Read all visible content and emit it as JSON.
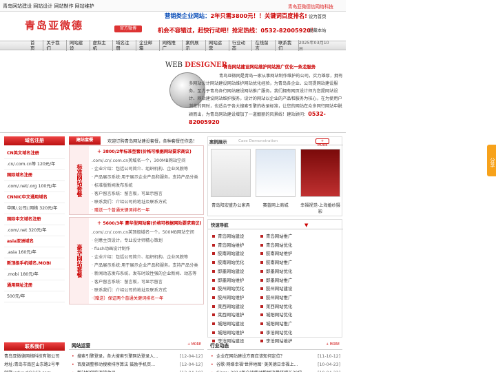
{
  "topbar": {
    "left": "青岛网站建设 网站设计 网站制作 网站维护",
    "right": "青岛亚微德信网络科技"
  },
  "logo": "青岛亚微德",
  "badge": "官方微博",
  "slogan1_a": "营销类企业网站：",
  "slogan1_b": "2年只需3800元！！关键词百度排名!",
  "slogan2": "机会不容错过，赶快行动吧！抢定热线：0532-82005920！",
  "set_home": "设为首页",
  "favorite": "收藏本站",
  "nav": [
    "首 页",
    "关于我们",
    "网站建设",
    "虚拟主机",
    "域名注册",
    "企业邮箱",
    "网络推广",
    "案例展示",
    "网站运营",
    "行业动态",
    "在线留言",
    "联系我们"
  ],
  "date": "2025年03月10日",
  "hero": {
    "web": "WEB",
    "designer": "DESIGNER",
    "tag": "青岛网站建设网站维护网站推广优化一条龙服务",
    "text": "青岛亚微网是青岛一家从事网站制作维护的公司，实力雄厚，拥有多网站设计网站建设网站维护网站优化经验，为青岛各企业、公司提网站建设服务，至力于青岛各行网站建设网站推广服务。我们拥有网页设计师为您提网站设计、网站建设网站维护服务，设计的网站以企业的产品和服务为核心，在为使用户浏览的同时，也适合于各大搜索引擎的收录标准，让您的网站在众多同行网站中脱颖而出，为青岛网站建设增加了一道靓丽的风景线！建站顾问：",
    "phone": "0532-82005920"
  },
  "sidebar": {
    "title": "域名注册",
    "items": [
      {
        "t": "CN英文域名注册",
        "red": true
      },
      {
        "t": ".cn/.com.cn等 120元/年",
        "red": false
      },
      {
        "t": "国际域名注册",
        "red": true
      },
      {
        "t": ".com/.net/.org 100元/年",
        "red": false
      },
      {
        "t": "CNNIC中文通用域名",
        "red": true
      },
      {
        "t": "中国/.公司/.网络 320元/年",
        "red": false
      },
      {
        "t": "国际中文域名注册",
        "red": true
      },
      {
        "t": ".com/.net 320元/年",
        "red": false
      },
      {
        "t": "asia亚洲域名",
        "red": true
      },
      {
        "t": ".asia 160元/年",
        "red": false
      },
      {
        "t": "新顶级手机域名.MOBI",
        "red": true
      },
      {
        "t": ".mobi 180元/年",
        "red": false
      },
      {
        "t": "通用网址注册",
        "red": true
      },
      {
        "t": "500元/年",
        "red": false
      }
    ]
  },
  "pkg_head": {
    "tab": "建站套餐",
    "text": "欢迎订购青岛网站建设套餐，各种套餐任你选！"
  },
  "pkg1": {
    "side": "标准网站套餐",
    "head": "＋ 3800/2年标准型套(价格可根据网站要求商议)",
    "items": [
      {
        "t": ".com/.cn/.com.cn英域名一个，300MB网站空间",
        "red": false
      },
      {
        "t": "· 企业介绍：包括公司简介、组织机构、企业风貌等",
        "red": false
      },
      {
        "t": "· 产品展示系统:用于展示企业产品和服务。支持产品分类",
        "red": false
      },
      {
        "t": "· 标准版新闻发布系统",
        "red": false
      },
      {
        "t": "· 客户留言系统：留言板，可显示留言",
        "red": false
      },
      {
        "t": "· 联系我们：介绍公司的地址及联系方式",
        "red": false
      },
      {
        "t": "· 赠送一个普通关键词排名一年",
        "red": true
      }
    ]
  },
  "pkg2": {
    "side": "豪华网站套餐",
    "head": "＋ 5600/3年 豪华型网站套(价格可根据网站要求商议)",
    "items": [
      {
        "t": ".com/.cn/.com.cn英顶级域名一个，500MB网站空间",
        "red": false
      },
      {
        "t": "· 创意主页设计，专业设计师精心策划",
        "red": false
      },
      {
        "t": "· flash动画设计制作",
        "red": false
      },
      {
        "t": "· 企业介绍：包括公司简介、组织机构、企业风貌等",
        "red": false
      },
      {
        "t": "· 产品展示系统:用于展示企业产品和服务。支持产品分类",
        "red": false
      },
      {
        "t": "· 新闻动态发布系统，发布时效性强的企业新闻、动态等",
        "red": false
      },
      {
        "t": "· 客户留言系统：留言板，可显示留言",
        "red": false
      },
      {
        "t": "· 联系我们：介绍公司的地址及联系方式",
        "red": false
      },
      {
        "t": "·（赠送）保证两个普通关键词排名一年",
        "red": true
      }
    ]
  },
  "cases": {
    "title": "案例展示",
    "sub": "Case Demonstration",
    "more": "+ MORE",
    "items": [
      "青岛阳宏盛办公家具",
      "赛普网上商城",
      "幸福视觉-上海婚纱摄影"
    ]
  },
  "quick": {
    "title": "快速导航",
    "col1": [
      "青岛网站建设",
      "青岛网站维护",
      "胶南网站建设",
      "胶南网站优化",
      "即墨网站建设",
      "即墨网站维护",
      "胶州网站优化",
      "胶州网站维护",
      "莱西网站建设",
      "莱西网站维护",
      "城阳网站建设",
      "城阳网站维护",
      "李沧网站建设"
    ],
    "col2": [
      "青岛网站推广",
      "青岛网站优化",
      "胶南网站维护",
      "胶南网站推广",
      "即墨网站优化",
      "即墨网站推广",
      "胶州网站建设",
      "胶州网站推广",
      "莱西网站优化",
      "城阳网站优化",
      "城阳网站推广",
      "李沧网站优化",
      "李沧网站维护"
    ]
  },
  "contact": {
    "title": "联系我们",
    "lines": [
      "青岛亚微德网络科技有限公司",
      "地址:青岛市南区山东路2号甲",
      "邮箱:qdywd@163.com"
    ]
  },
  "ops": {
    "title": "网站运营",
    "more": "+ MORE",
    "items": [
      {
        "t": "搜索引擎登录，各大搜索引擎网站登录入...",
        "d": "[12-04-12]"
      },
      {
        "t": "百度调整移动搜索排序算法 鼓励手机页...",
        "d": "[12-04-12]"
      },
      {
        "t": "新站如何快速被收录",
        "d": "[12-04-10]"
      }
    ]
  },
  "industry": {
    "title": "行业动态",
    "more": "+ MORE",
    "items": [
      {
        "t": "企业在网站建设方面应该知何定位？",
        "d": "[11-10-12]"
      },
      {
        "t": "谷歌·网络幸福'世界地图' 美英德日幸福上...",
        "d": "[10-04-23]"
      },
      {
        "t": "Cisco: 2014年全球移动数据流量将增长39倍",
        "d": "[10-04-23]"
      }
    ]
  },
  "share": "分享"
}
